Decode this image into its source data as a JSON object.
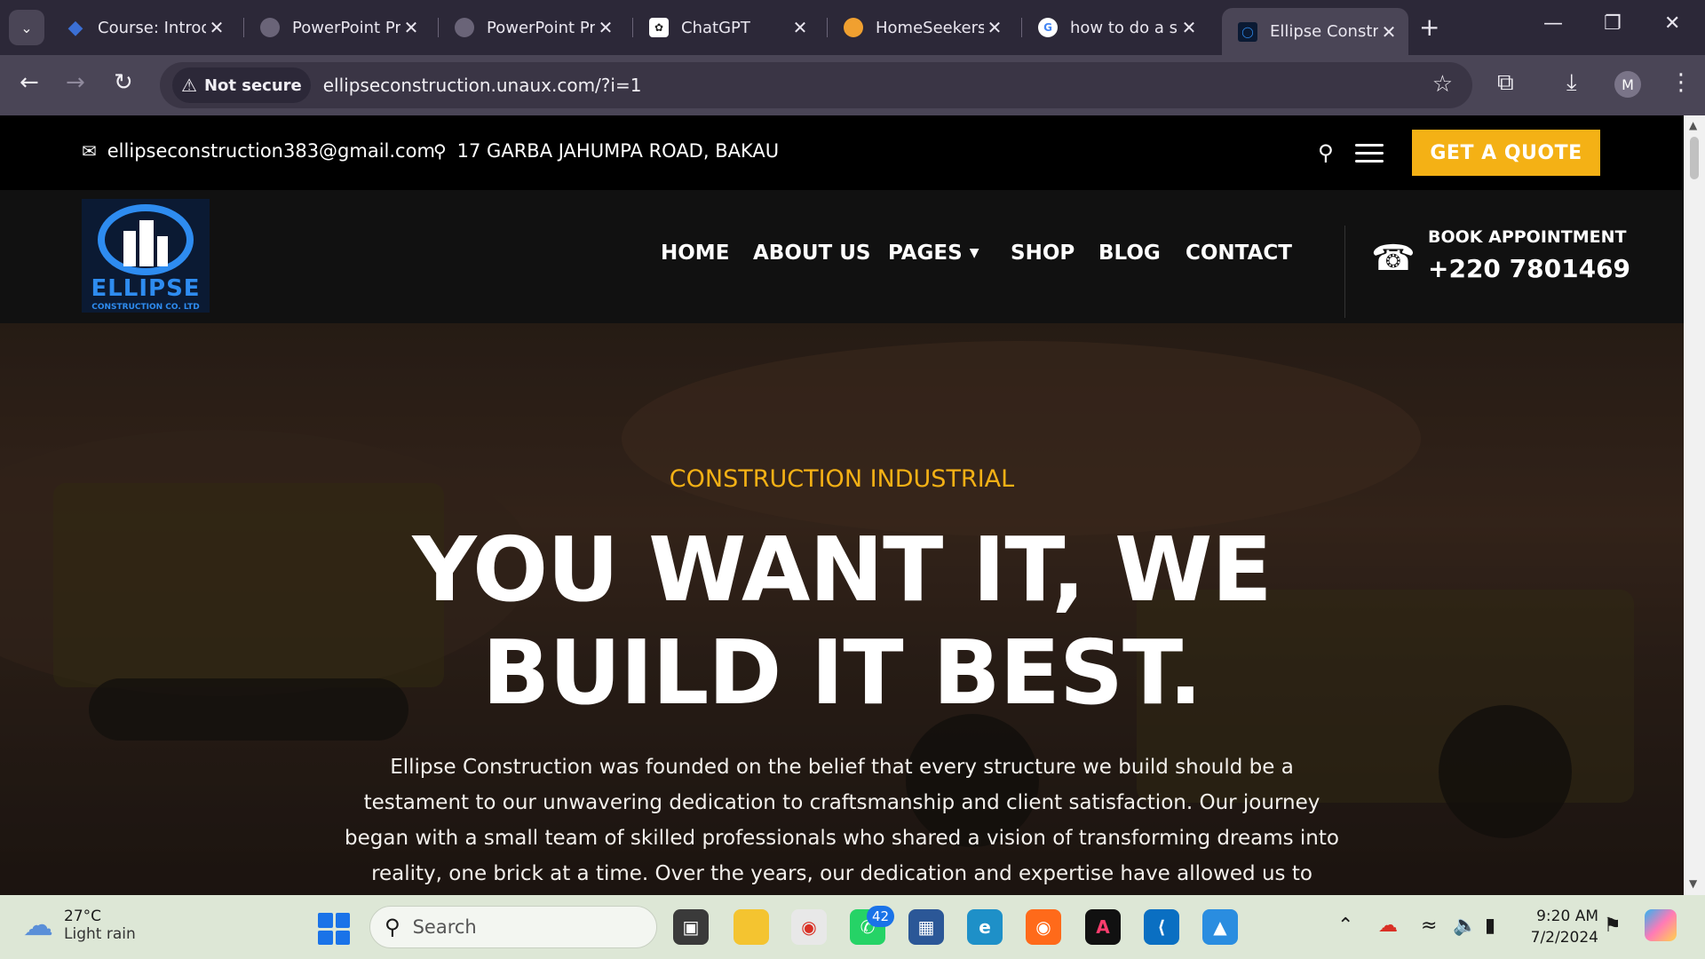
{
  "browser": {
    "tabs": [
      {
        "title": "Course: Introd",
        "favicon": "diamond-icon",
        "color": "#3b6fd4"
      },
      {
        "title": "PowerPoint Pr",
        "favicon": "globe-icon",
        "color": "#8a8496"
      },
      {
        "title": "PowerPoint Pr",
        "favicon": "globe-icon",
        "color": "#8a8496"
      },
      {
        "title": "ChatGPT",
        "favicon": "chatgpt-icon",
        "color": "#ffffff"
      },
      {
        "title": "HomeSeekers",
        "favicon": "homeseekers-icon",
        "color": "#f0a030"
      },
      {
        "title": "how to do a s",
        "favicon": "google-icon",
        "color": "#ffffff"
      },
      {
        "title": "Ellipse Constr",
        "favicon": "ellipse-icon",
        "color": "#2e8cf0",
        "active": true
      }
    ],
    "not_secure_label": "Not secure",
    "url": "ellipseconstruction.unaux.com/?i=1",
    "profile_initial": "M"
  },
  "site": {
    "topbar": {
      "email": "ellipseconstruction383@gmail.com",
      "address": "17 GARBA JAHUMPA ROAD, BAKAU",
      "quote_label": "GET A QUOTE"
    },
    "logo": {
      "name": "ELLIPSE",
      "sub": "CONSTRUCTION CO. LTD"
    },
    "nav": {
      "home": "HOME",
      "about": "ABOUT US",
      "pages": "PAGES",
      "shop": "SHOP",
      "blog": "BLOG",
      "contact": "CONTACT"
    },
    "booking": {
      "label": "BOOK APPOINTMENT",
      "phone": "+220 7801469"
    },
    "hero": {
      "kicker": "CONSTRUCTION INDUSTRIAL",
      "headline_line1": "YOU WANT IT, WE",
      "headline_line2": "BUILD IT BEST.",
      "paragraph": "Ellipse Construction was founded on the belief that every structure we build should be a testament to our unwavering dedication to craftsmanship and client satisfaction. Our journey began with a small team of skilled professionals who shared a vision of transforming dreams into reality, one brick at a time. Over the years, our dedication and expertise have allowed us to evolve into a trusted"
    },
    "accent_color": "#f4b115"
  },
  "taskbar": {
    "weather": {
      "temp": "27°C",
      "condition": "Light rain"
    },
    "search_label": "Search",
    "whatsapp_badge": "42",
    "time": "9:20 AM",
    "date": "7/2/2024"
  }
}
